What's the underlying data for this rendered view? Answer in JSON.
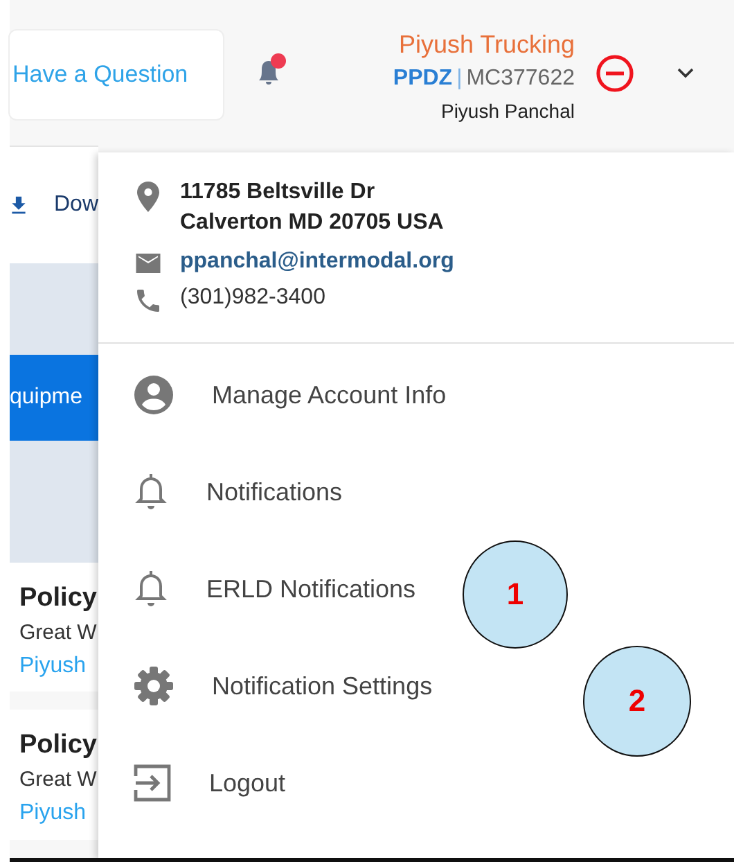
{
  "header": {
    "help_button": "Have a Question",
    "notifications": {
      "unread": true
    },
    "company": {
      "name": "Piyush Trucking",
      "code": "PPDZ",
      "separator": "|",
      "mc_number": "MC377622",
      "user": "Piyush Panchal"
    }
  },
  "background": {
    "toolbar_action": "Dow",
    "tab": "quipme",
    "cards": [
      {
        "title": "Policy",
        "line": "Great W",
        "link": "Piyush"
      },
      {
        "title": "Policy",
        "line": "Great W",
        "link": "Piyush"
      }
    ]
  },
  "account_menu": {
    "address": [
      "11785 Beltsville Dr",
      "Calverton MD 20705 USA"
    ],
    "email": "ppanchal@intermodal.org",
    "phone": "(301)982-3400",
    "items": [
      {
        "label": "Manage Account Info",
        "kind": "account"
      },
      {
        "label": "Notifications",
        "kind": "bell"
      },
      {
        "label": "ERLD Notifications",
        "kind": "bell"
      },
      {
        "label": "Notification Settings",
        "kind": "gear"
      },
      {
        "label": "Logout",
        "kind": "logout"
      }
    ]
  },
  "callouts": [
    {
      "label": "1"
    },
    {
      "label": "2"
    }
  ]
}
